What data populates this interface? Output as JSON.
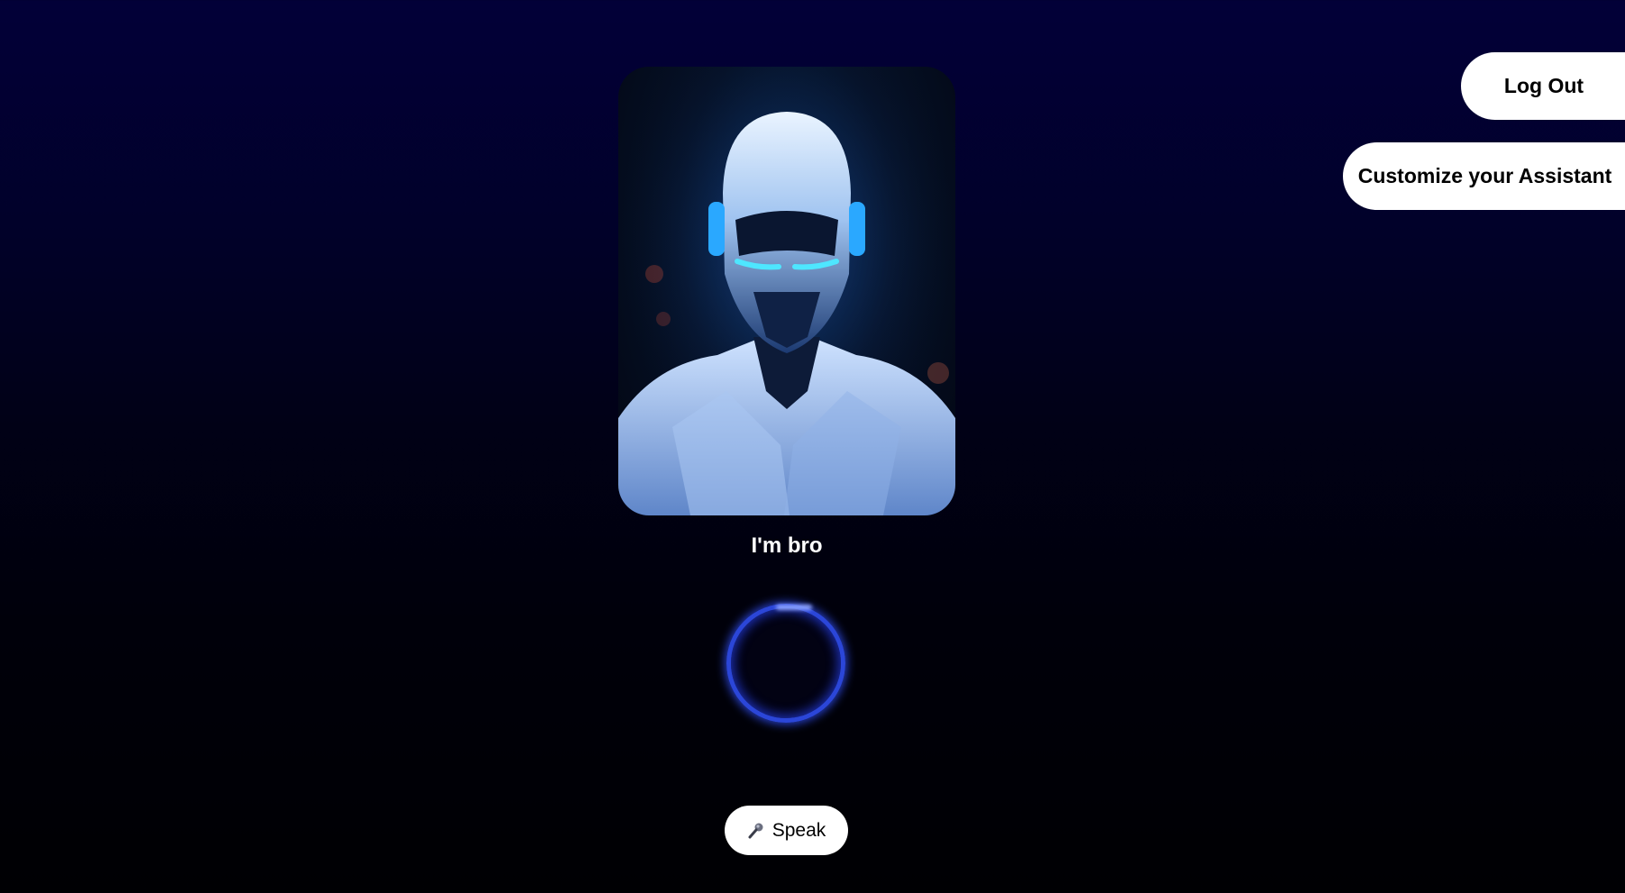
{
  "header": {
    "logout_label": "Log Out",
    "customize_label": "Customize your Assistant"
  },
  "assistant": {
    "name": "I'm bro",
    "avatar_icon": "robot-avatar-image"
  },
  "voice": {
    "orb_icon": "voice-orb-ring",
    "speak_label": "Speak",
    "speak_icon": "microphone-icon"
  },
  "colors": {
    "background_top": "#020038",
    "background_bottom": "#000003",
    "orb_accent": "#2b46d8",
    "button_bg": "#ffffff"
  }
}
